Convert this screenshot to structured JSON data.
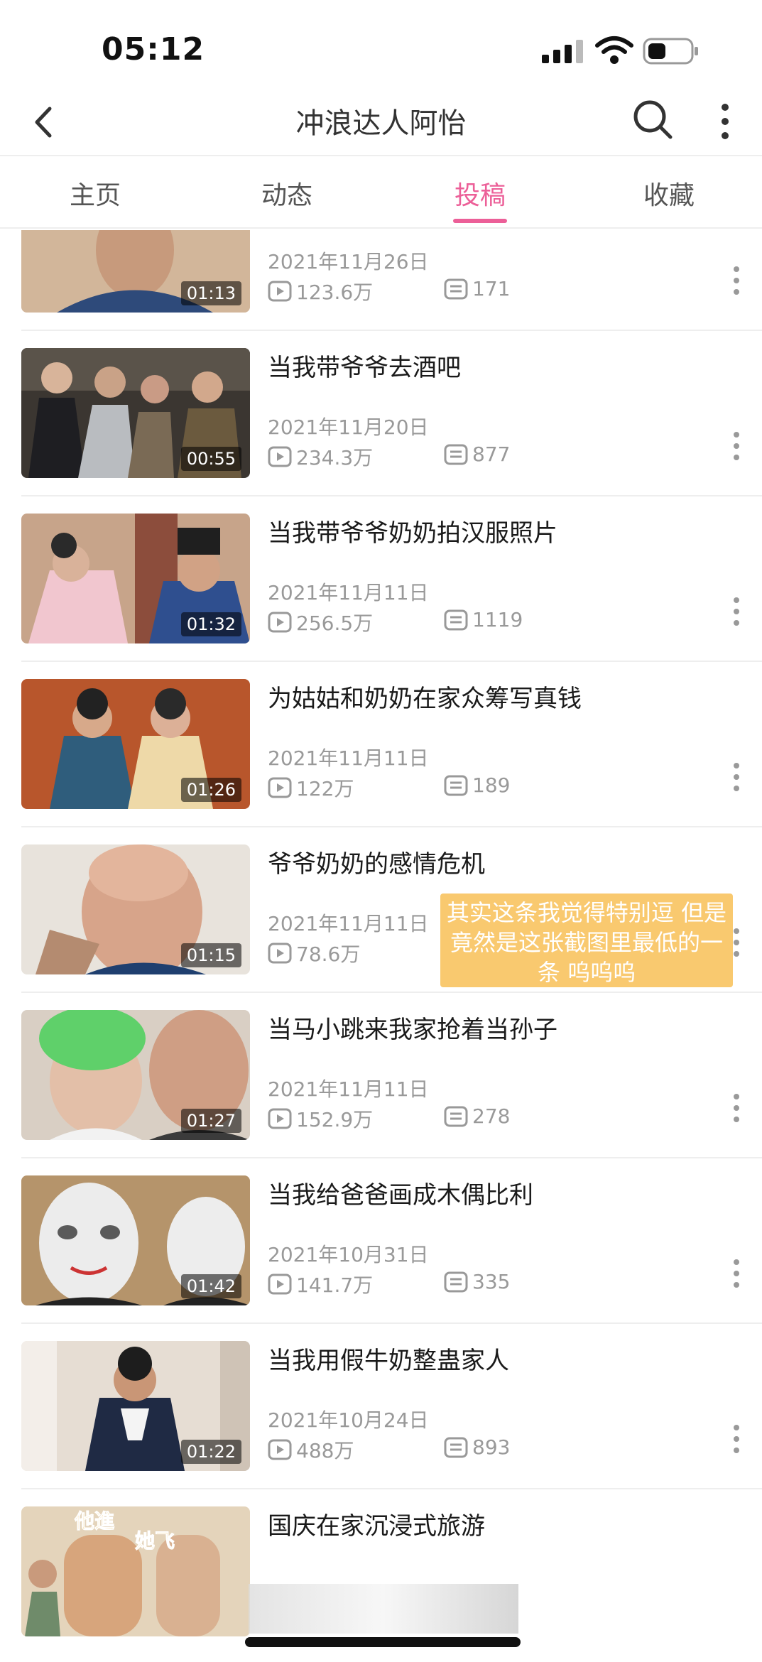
{
  "status_bar": {
    "time": "05:12"
  },
  "header": {
    "title": "冲浪达人阿怡"
  },
  "tabs": [
    {
      "label": "主页",
      "active": false
    },
    {
      "label": "动态",
      "active": false
    },
    {
      "label": "投稿",
      "active": true
    },
    {
      "label": "收藏",
      "active": false
    }
  ],
  "accent_color": "#ec5f98",
  "videos": [
    {
      "title": "",
      "duration": "01:13",
      "date": "2021年11月26日",
      "plays": "123.6万",
      "comments": "171"
    },
    {
      "title": "当我带爷爷去酒吧",
      "duration": "00:55",
      "date": "2021年11月20日",
      "plays": "234.3万",
      "comments": "877"
    },
    {
      "title": "当我带爷爷奶奶拍汉服照片",
      "duration": "01:32",
      "date": "2021年11月11日",
      "plays": "256.5万",
      "comments": "1119"
    },
    {
      "title": "为姑姑和奶奶在家众筹写真钱",
      "duration": "01:26",
      "date": "2021年11月11日",
      "plays": "122万",
      "comments": "189"
    },
    {
      "title": "爷爷奶奶的感情危机",
      "duration": "01:15",
      "date": "2021年11月11日",
      "plays": "78.6万",
      "comments": ""
    },
    {
      "title": "当马小跳来我家抢着当孙子",
      "duration": "01:27",
      "date": "2021年11月11日",
      "plays": "152.9万",
      "comments": "278"
    },
    {
      "title": "当我给爸爸画成木偶比利",
      "duration": "01:42",
      "date": "2021年10月31日",
      "plays": "141.7万",
      "comments": "335"
    },
    {
      "title": "当我用假牛奶整蛊家人",
      "duration": "01:22",
      "date": "2021年10月24日",
      "plays": "488万",
      "comments": "893"
    },
    {
      "title": "国庆在家沉浸式旅游",
      "duration": "",
      "date": "",
      "plays": "",
      "comments": ""
    }
  ],
  "annotation": {
    "text": "其实这条我觉得特别逗 但是竟然是这张截图里最低的一条 呜呜呜"
  },
  "thumb9_overlay": {
    "left": "他進",
    "right": "她飞"
  }
}
